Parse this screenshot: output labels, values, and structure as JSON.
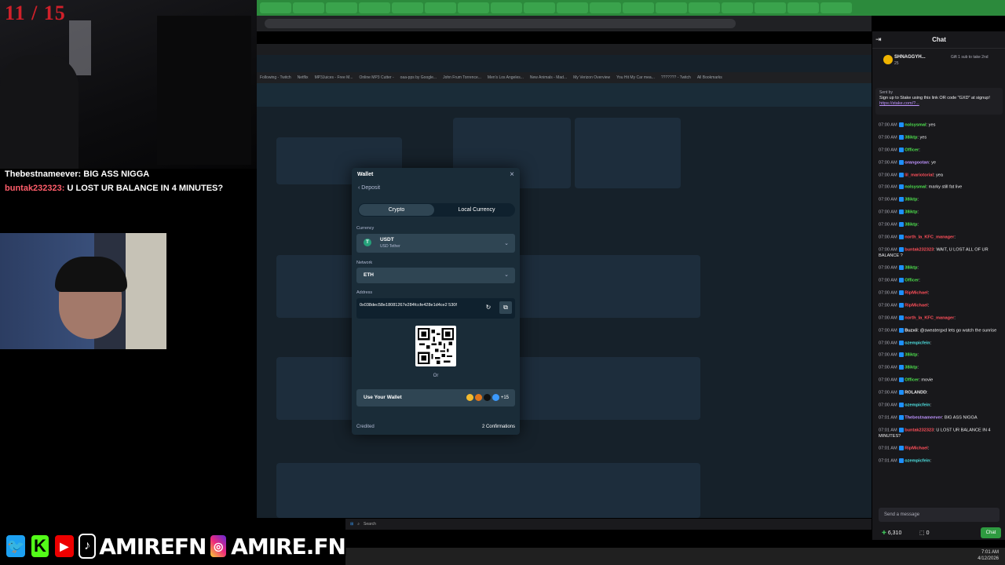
{
  "counter": "11 / 15",
  "overlay_messages": [
    {
      "user": "Thebestnameever:",
      "text": " BIG ASS NIGGA"
    },
    {
      "user": "buntak232323:",
      "text": " U LOST UR BALANCE IN 4 MINUTES?"
    }
  ],
  "bookmarks": [
    "Following - Twitch",
    "Netflix",
    "MP3Juices - Free M...",
    "Online MP3 Cutter -",
    "oaa-pps by Google...",
    "John Frum Torrence...",
    "Men's Los Angeles...",
    "New Animals - Mad...",
    "My Verizon Overview",
    "You Hit My Car mea...",
    "??????? - Twitch",
    "All Bookmarks"
  ],
  "modal": {
    "title": "Wallet",
    "close": "×",
    "back": "‹  Deposit",
    "tab_crypto": "Crypto",
    "tab_local": "Local Currency",
    "currency_label": "Currency",
    "currency_value": "USDT",
    "currency_sub": "USD Tether",
    "currency_symbol": "T",
    "network_label": "Network",
    "network_value": "ETH",
    "address_label": "Address",
    "address_value": "0x038dec58e18081267e284fccfe428e1d4ce2 530f",
    "or": "Or",
    "wallet_button": "Use Your Wallet",
    "wallet_more": "+15",
    "credited": "Credited",
    "confirmations": "2 Confirmations"
  },
  "chat": {
    "title": "Chat",
    "gift_user": "SHNAGGYH...",
    "gift_count": "25",
    "gift_text": "Gift 1 sub to take 2nd",
    "pinned_by": "Sent by",
    "pinned_text": "Sign up to Stake using this link OR code \"GXD\" at signup!",
    "pinned_link": "https://stake.com/?...",
    "messages": [
      {
        "time": "07:00 AM",
        "user": "nolsysmal",
        "color": "#4fe34f",
        "text": ": yes"
      },
      {
        "time": "07:00 AM",
        "user": "38iktp",
        "color": "#4fe34f",
        "text": ": yes"
      },
      {
        "time": "07:00 AM",
        "user": "Officer",
        "color": "#4fe34f",
        "text": ":"
      },
      {
        "time": "07:00 AM",
        "user": "orangootan",
        "color": "#bf94ff",
        "text": ": ye"
      },
      {
        "time": "07:00 AM",
        "user": "lil_mariotorial",
        "color": "#ff4f5a",
        "text": ": yea"
      },
      {
        "time": "07:00 AM",
        "user": "nolsysmal",
        "color": "#4fe34f",
        "text": ": marky still fat live"
      },
      {
        "time": "07:00 AM",
        "user": "38iktp",
        "color": "#4fe34f",
        "text": ":"
      },
      {
        "time": "07:00 AM",
        "user": "38iktp",
        "color": "#4fe34f",
        "text": ":"
      },
      {
        "time": "07:00 AM",
        "user": "38iktp",
        "color": "#4fe34f",
        "text": ":"
      },
      {
        "time": "07:00 AM",
        "user": "north_la_KFC_manager",
        "color": "#ff4f5a",
        "text": ":"
      },
      {
        "time": "07:00 AM",
        "user": "buntak232323",
        "color": "#ff4f5a",
        "text": ": WAIT, U LOST ALL OF UR BALANCE ?"
      },
      {
        "time": "07:00 AM",
        "user": "38iktp",
        "color": "#4fe34f",
        "text": ":"
      },
      {
        "time": "07:00 AM",
        "user": "Officer",
        "color": "#4fe34f",
        "text": ":"
      },
      {
        "time": "07:00 AM",
        "user": "RipMichael",
        "color": "#ff4f5a",
        "text": ":"
      },
      {
        "time": "07:00 AM",
        "user": "RipMichael",
        "color": "#ff4f5a",
        "text": ":"
      },
      {
        "time": "07:00 AM",
        "user": "north_la_KFC_manager",
        "color": "#ff4f5a",
        "text": ":"
      },
      {
        "time": "07:00 AM",
        "user": "Buzxii",
        "color": "#efeff1",
        "text": ": @sweatergxd lets go watch the sunrise"
      },
      {
        "time": "07:00 AM",
        "user": "ozempicfein",
        "color": "#4fe3e3",
        "text": ":"
      },
      {
        "time": "07:00 AM",
        "user": "38iktp",
        "color": "#4fe34f",
        "text": ":"
      },
      {
        "time": "07:00 AM",
        "user": "38iktp",
        "color": "#4fe34f",
        "text": ":"
      },
      {
        "time": "07:00 AM",
        "user": "Officer",
        "color": "#4fe34f",
        "text": ": movie"
      },
      {
        "time": "07:00 AM",
        "user": "ROLANDD",
        "color": "#efeff1",
        "text": ":"
      },
      {
        "time": "07:00 AM",
        "user": "ozempicfein",
        "color": "#4fe3e3",
        "text": ":"
      },
      {
        "time": "07:01 AM",
        "user": "Thebestnameever",
        "color": "#bf94ff",
        "text": ": BIG ASS NIGGA"
      },
      {
        "time": "07:01 AM",
        "user": "buntak232323",
        "color": "#ff4f5a",
        "text": ": U LOST UR BALANCE IN 4 MINUTES?"
      },
      {
        "time": "07:01 AM",
        "user": "RipMichael",
        "color": "#ff4f5a",
        "text": ":"
      },
      {
        "time": "07:01 AM",
        "user": "ozempicfein",
        "color": "#4fe3e3",
        "text": ":"
      }
    ],
    "send_placeholder": "Send a message",
    "points": "6,310",
    "points2": "0",
    "chat_button": "Chat"
  },
  "clock": {
    "time": "7:01 AM",
    "date": "4/12/2026"
  },
  "inner_search": "Search",
  "socials": {
    "twitter": "🐦",
    "kick": "K",
    "youtube": "▶",
    "tiktok": "♪",
    "handle1": "AMIREFN",
    "instagram": "◎",
    "handle2": "AMIRE.FN"
  }
}
